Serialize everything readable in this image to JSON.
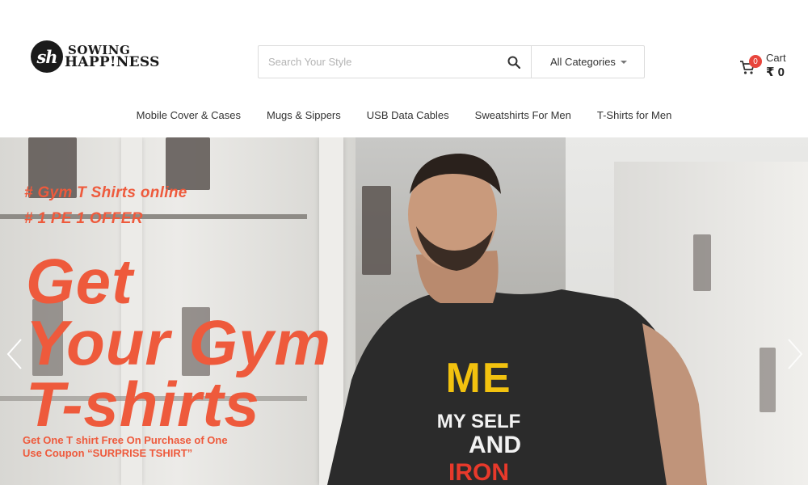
{
  "brand": {
    "logo_mark": "sh",
    "line1": "SOWING",
    "line2": "HAPP!NESS"
  },
  "search": {
    "placeholder": "Search Your Style",
    "value": "",
    "icon": "search-icon"
  },
  "category": {
    "selected": "All Categories"
  },
  "cart": {
    "label": "Cart",
    "count": "0",
    "total": "₹ 0",
    "icon": "cart-icon"
  },
  "nav": {
    "items": [
      {
        "label": "Mobile Cover & Cases"
      },
      {
        "label": "Mugs & Sippers"
      },
      {
        "label": "USB Data Cables"
      },
      {
        "label": "Sweatshirts For Men"
      },
      {
        "label": "T-Shirts for Men"
      }
    ]
  },
  "hero": {
    "tag1": "# Gym T Shirts online",
    "tag2": "# 1 PE 1 OFFER",
    "headline": [
      "Get",
      "Your Gym",
      "T-shirts"
    ],
    "sub1": "Get One T shirt Free On Purchase of One",
    "sub2": "Use Coupon “SURPRISE TSHIRT”",
    "shirt_print": {
      "line1": "ME",
      "line2": "MY SELF",
      "line3": "AND",
      "line4": "IRON"
    },
    "accent_color": "#ee5a3c",
    "prev_icon": "chevron-left-icon",
    "next_icon": "chevron-right-icon"
  }
}
